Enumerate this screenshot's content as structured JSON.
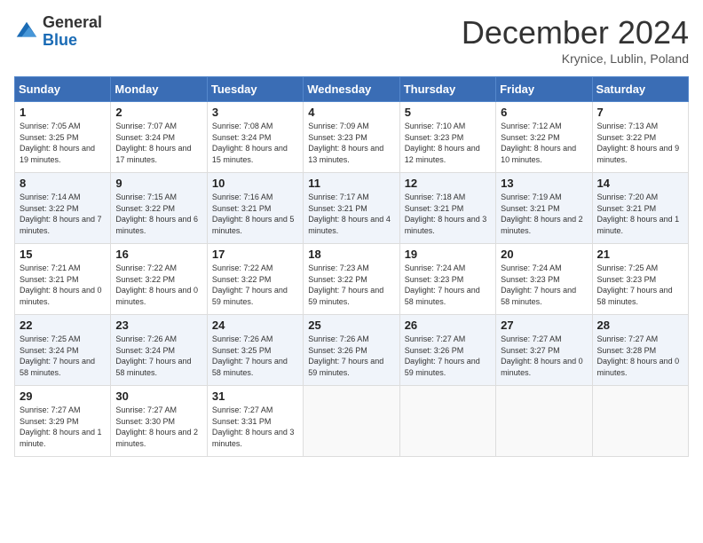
{
  "header": {
    "logo_general": "General",
    "logo_blue": "Blue",
    "month_title": "December 2024",
    "location": "Krynice, Lublin, Poland"
  },
  "calendar": {
    "days_of_week": [
      "Sunday",
      "Monday",
      "Tuesday",
      "Wednesday",
      "Thursday",
      "Friday",
      "Saturday"
    ],
    "weeks": [
      [
        {
          "day": "1",
          "sunrise": "7:05 AM",
          "sunset": "3:25 PM",
          "daylight": "8 hours and 19 minutes."
        },
        {
          "day": "2",
          "sunrise": "7:07 AM",
          "sunset": "3:24 PM",
          "daylight": "8 hours and 17 minutes."
        },
        {
          "day": "3",
          "sunrise": "7:08 AM",
          "sunset": "3:24 PM",
          "daylight": "8 hours and 15 minutes."
        },
        {
          "day": "4",
          "sunrise": "7:09 AM",
          "sunset": "3:23 PM",
          "daylight": "8 hours and 13 minutes."
        },
        {
          "day": "5",
          "sunrise": "7:10 AM",
          "sunset": "3:23 PM",
          "daylight": "8 hours and 12 minutes."
        },
        {
          "day": "6",
          "sunrise": "7:12 AM",
          "sunset": "3:22 PM",
          "daylight": "8 hours and 10 minutes."
        },
        {
          "day": "7",
          "sunrise": "7:13 AM",
          "sunset": "3:22 PM",
          "daylight": "8 hours and 9 minutes."
        }
      ],
      [
        {
          "day": "8",
          "sunrise": "7:14 AM",
          "sunset": "3:22 PM",
          "daylight": "8 hours and 7 minutes."
        },
        {
          "day": "9",
          "sunrise": "7:15 AM",
          "sunset": "3:22 PM",
          "daylight": "8 hours and 6 minutes."
        },
        {
          "day": "10",
          "sunrise": "7:16 AM",
          "sunset": "3:21 PM",
          "daylight": "8 hours and 5 minutes."
        },
        {
          "day": "11",
          "sunrise": "7:17 AM",
          "sunset": "3:21 PM",
          "daylight": "8 hours and 4 minutes."
        },
        {
          "day": "12",
          "sunrise": "7:18 AM",
          "sunset": "3:21 PM",
          "daylight": "8 hours and 3 minutes."
        },
        {
          "day": "13",
          "sunrise": "7:19 AM",
          "sunset": "3:21 PM",
          "daylight": "8 hours and 2 minutes."
        },
        {
          "day": "14",
          "sunrise": "7:20 AM",
          "sunset": "3:21 PM",
          "daylight": "8 hours and 1 minute."
        }
      ],
      [
        {
          "day": "15",
          "sunrise": "7:21 AM",
          "sunset": "3:21 PM",
          "daylight": "8 hours and 0 minutes."
        },
        {
          "day": "16",
          "sunrise": "7:22 AM",
          "sunset": "3:22 PM",
          "daylight": "8 hours and 0 minutes."
        },
        {
          "day": "17",
          "sunrise": "7:22 AM",
          "sunset": "3:22 PM",
          "daylight": "7 hours and 59 minutes."
        },
        {
          "day": "18",
          "sunrise": "7:23 AM",
          "sunset": "3:22 PM",
          "daylight": "7 hours and 59 minutes."
        },
        {
          "day": "19",
          "sunrise": "7:24 AM",
          "sunset": "3:23 PM",
          "daylight": "7 hours and 58 minutes."
        },
        {
          "day": "20",
          "sunrise": "7:24 AM",
          "sunset": "3:23 PM",
          "daylight": "7 hours and 58 minutes."
        },
        {
          "day": "21",
          "sunrise": "7:25 AM",
          "sunset": "3:23 PM",
          "daylight": "7 hours and 58 minutes."
        }
      ],
      [
        {
          "day": "22",
          "sunrise": "7:25 AM",
          "sunset": "3:24 PM",
          "daylight": "7 hours and 58 minutes."
        },
        {
          "day": "23",
          "sunrise": "7:26 AM",
          "sunset": "3:24 PM",
          "daylight": "7 hours and 58 minutes."
        },
        {
          "day": "24",
          "sunrise": "7:26 AM",
          "sunset": "3:25 PM",
          "daylight": "7 hours and 58 minutes."
        },
        {
          "day": "25",
          "sunrise": "7:26 AM",
          "sunset": "3:26 PM",
          "daylight": "7 hours and 59 minutes."
        },
        {
          "day": "26",
          "sunrise": "7:27 AM",
          "sunset": "3:26 PM",
          "daylight": "7 hours and 59 minutes."
        },
        {
          "day": "27",
          "sunrise": "7:27 AM",
          "sunset": "3:27 PM",
          "daylight": "8 hours and 0 minutes."
        },
        {
          "day": "28",
          "sunrise": "7:27 AM",
          "sunset": "3:28 PM",
          "daylight": "8 hours and 0 minutes."
        }
      ],
      [
        {
          "day": "29",
          "sunrise": "7:27 AM",
          "sunset": "3:29 PM",
          "daylight": "8 hours and 1 minute."
        },
        {
          "day": "30",
          "sunrise": "7:27 AM",
          "sunset": "3:30 PM",
          "daylight": "8 hours and 2 minutes."
        },
        {
          "day": "31",
          "sunrise": "7:27 AM",
          "sunset": "3:31 PM",
          "daylight": "8 hours and 3 minutes."
        },
        null,
        null,
        null,
        null
      ]
    ]
  }
}
